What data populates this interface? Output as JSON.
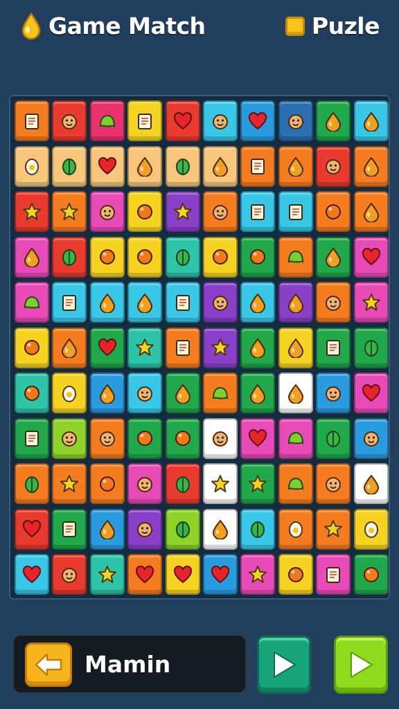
{
  "header": {
    "title": "Game Match",
    "right_label": "Puzle",
    "title_icon": "drop-icon",
    "right_icon": "square-icon"
  },
  "board": {
    "rows": 11,
    "cols": 10,
    "tiles": [
      [
        [
          "#f57c1f",
          "card"
        ],
        [
          "#e83a2e",
          "face"
        ],
        [
          "#e8326e",
          "slime"
        ],
        [
          "#f7d321",
          "card"
        ],
        [
          "#e83a2e",
          "heart"
        ],
        [
          "#39c7e8",
          "face"
        ],
        [
          "#2b9be0",
          "heart"
        ],
        [
          "#2a6fb0",
          "face"
        ],
        [
          "#20a84a",
          "drop"
        ],
        [
          "#39c7e8",
          "drop"
        ]
      ],
      [
        [
          "#f7c67a",
          "egg"
        ],
        [
          "#f7c67a",
          "leaf"
        ],
        [
          "#f7c67a",
          "heart"
        ],
        [
          "#f7c67a",
          "drop"
        ],
        [
          "#f7c67a",
          "leaf"
        ],
        [
          "#f7c67a",
          "drop"
        ],
        [
          "#f57c1f",
          "card"
        ],
        [
          "#f57c1f",
          "drop"
        ],
        [
          "#e83a2e",
          "face"
        ],
        [
          "#f57c1f",
          "drop"
        ]
      ],
      [
        [
          "#e83a2e",
          "star"
        ],
        [
          "#f57c1f",
          "star"
        ],
        [
          "#e84ab8",
          "face"
        ],
        [
          "#f7d321",
          "circle"
        ],
        [
          "#8a3fc8",
          "star"
        ],
        [
          "#f57c1f",
          "face"
        ],
        [
          "#39c7e8",
          "card"
        ],
        [
          "#39c7e8",
          "card"
        ],
        [
          "#f57c1f",
          "circle"
        ],
        [
          "#f57c1f",
          "drop"
        ]
      ],
      [
        [
          "#e84ab8",
          "drop"
        ],
        [
          "#e83a2e",
          "leaf"
        ],
        [
          "#f7d321",
          "circle"
        ],
        [
          "#f7d321",
          "circle"
        ],
        [
          "#2ec4a8",
          "leaf"
        ],
        [
          "#f7d321",
          "circle"
        ],
        [
          "#20a84a",
          "circle"
        ],
        [
          "#f57c1f",
          "slime"
        ],
        [
          "#20a84a",
          "drop"
        ],
        [
          "#e84ab8",
          "heart"
        ]
      ],
      [
        [
          "#e84ab8",
          "slime"
        ],
        [
          "#39c7e8",
          "card"
        ],
        [
          "#39c7e8",
          "drop"
        ],
        [
          "#39c7e8",
          "drop"
        ],
        [
          "#39c7e8",
          "card"
        ],
        [
          "#8a3fc8",
          "face"
        ],
        [
          "#39c7e8",
          "drop"
        ],
        [
          "#8a3fc8",
          "drop"
        ],
        [
          "#f57c1f",
          "face"
        ],
        [
          "#e84ab8",
          "star"
        ]
      ],
      [
        [
          "#f7d321",
          "circle"
        ],
        [
          "#f57c1f",
          "drop"
        ],
        [
          "#20a84a",
          "heart"
        ],
        [
          "#2ec4a8",
          "star"
        ],
        [
          "#f57c1f",
          "card"
        ],
        [
          "#8a3fc8",
          "star"
        ],
        [
          "#20a84a",
          "drop"
        ],
        [
          "#f7d321",
          "drop"
        ],
        [
          "#20a84a",
          "card"
        ],
        [
          "#20a84a",
          "leaf"
        ]
      ],
      [
        [
          "#2ec4a8",
          "circle"
        ],
        [
          "#f7d321",
          "egg"
        ],
        [
          "#2b9be0",
          "drop"
        ],
        [
          "#39c7e8",
          "face"
        ],
        [
          "#20a84a",
          "drop"
        ],
        [
          "#f57c1f",
          "slime"
        ],
        [
          "#20a84a",
          "drop"
        ],
        [
          "#ffffff",
          "drop"
        ],
        [
          "#2b9be0",
          "face"
        ],
        [
          "#e84ab8",
          "heart"
        ]
      ],
      [
        [
          "#20a84a",
          "card"
        ],
        [
          "#8fd22a",
          "face"
        ],
        [
          "#f57c1f",
          "face"
        ],
        [
          "#20a84a",
          "circle"
        ],
        [
          "#20a84a",
          "circle"
        ],
        [
          "#ffffff",
          "face"
        ],
        [
          "#e84ab8",
          "heart"
        ],
        [
          "#e84ab8",
          "slime"
        ],
        [
          "#20a84a",
          "leaf"
        ],
        [
          "#2b9be0",
          "face"
        ]
      ],
      [
        [
          "#f57c1f",
          "leaf"
        ],
        [
          "#f57c1f",
          "star"
        ],
        [
          "#f57c1f",
          "circle"
        ],
        [
          "#e84ab8",
          "face"
        ],
        [
          "#e83a2e",
          "leaf"
        ],
        [
          "#ffffff",
          "star"
        ],
        [
          "#20a84a",
          "star"
        ],
        [
          "#f57c1f",
          "slime"
        ],
        [
          "#f57c1f",
          "face"
        ],
        [
          "#ffffff",
          "drop"
        ]
      ],
      [
        [
          "#e83a2e",
          "heart"
        ],
        [
          "#20a84a",
          "card"
        ],
        [
          "#2b9be0",
          "drop"
        ],
        [
          "#8a3fc8",
          "face"
        ],
        [
          "#8fd22a",
          "leaf"
        ],
        [
          "#ffffff",
          "drop"
        ],
        [
          "#39c7e8",
          "leaf"
        ],
        [
          "#f57c1f",
          "egg"
        ],
        [
          "#f57c1f",
          "star"
        ],
        [
          "#f7d321",
          "egg"
        ]
      ],
      [
        [
          "#39c7e8",
          "heart"
        ],
        [
          "#e83a2e",
          "face"
        ],
        [
          "#2ec4a8",
          "star"
        ],
        [
          "#f57c1f",
          "heart"
        ],
        [
          "#f7d321",
          "heart"
        ],
        [
          "#2b9be0",
          "heart"
        ],
        [
          "#e84ab8",
          "star"
        ],
        [
          "#f7d321",
          "circle"
        ],
        [
          "#e84ab8",
          "card"
        ],
        [
          "#20a84a",
          "circle"
        ]
      ]
    ]
  },
  "footer": {
    "back_icon": "back-arrow-icon",
    "mode_label": "Mamin",
    "play_icon": "play-icon",
    "colors": {
      "teal": "#18a57a",
      "lime": "#8fdc1e",
      "gold": "#f7b51d"
    }
  }
}
